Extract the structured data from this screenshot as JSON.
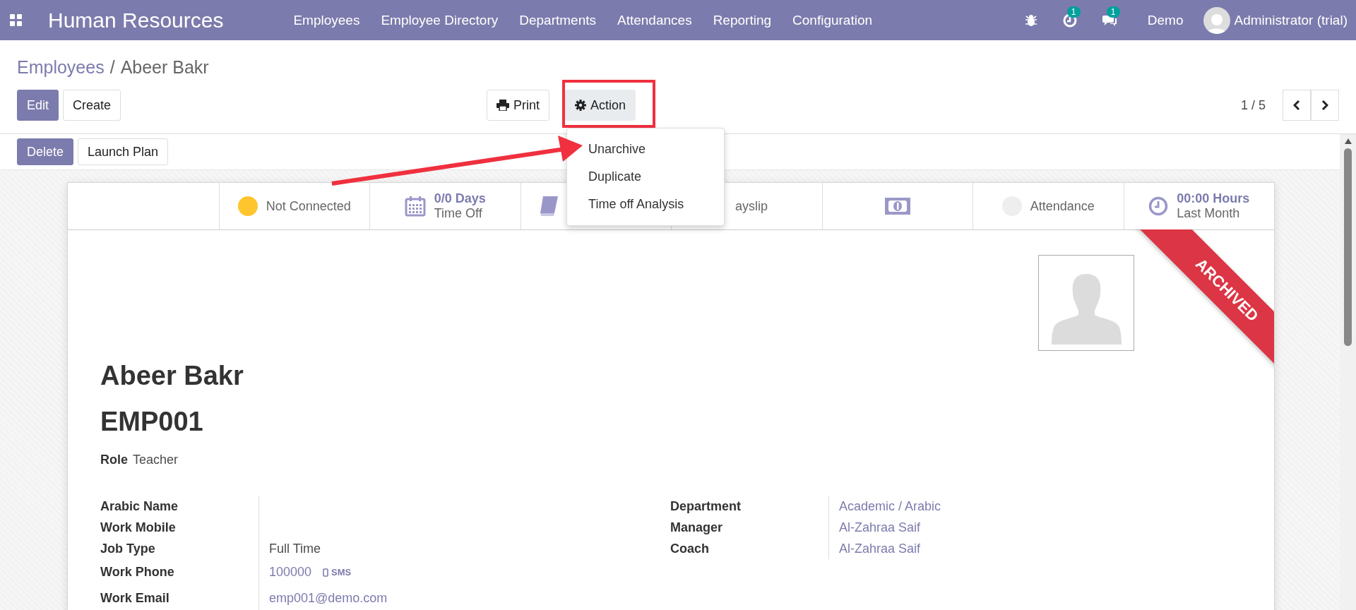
{
  "navbar": {
    "app_title": "Human Resources",
    "menu": [
      "Employees",
      "Employee Directory",
      "Departments",
      "Attendances",
      "Reporting",
      "Configuration"
    ],
    "activity_badge": "1",
    "message_badge": "1",
    "company": "Demo",
    "user": "Administrator (trial)"
  },
  "breadcrumb": {
    "parent": "Employees",
    "separator": "/",
    "current": "Abeer Bakr"
  },
  "toolbar": {
    "buttons": [
      {
        "label": "Edit",
        "kind": "primary"
      },
      {
        "label": "Create",
        "kind": "secondary"
      }
    ],
    "print": "Print",
    "action": "Action",
    "pager": "1 / 5"
  },
  "status_row": [
    {
      "label": "Delete",
      "kind": "primary"
    },
    {
      "label": "Launch Plan",
      "kind": "secondary"
    }
  ],
  "action_menu": {
    "items": [
      "Unarchive",
      "Duplicate",
      "Time off Analysis"
    ]
  },
  "stats": [
    {
      "kind": "presence",
      "label": "Not Connected",
      "color": "#ffc52f"
    },
    {
      "kind": "time_off",
      "value": "0/0 Days",
      "label": "Time Off"
    },
    {
      "kind": "contracts"
    },
    {
      "kind": "payslip",
      "label": "ayslip"
    },
    {
      "kind": "money"
    },
    {
      "kind": "attendance",
      "label": "Attendance",
      "color": "#eeeeee"
    },
    {
      "kind": "hours",
      "value": "00:00 Hours",
      "label": "Last Month"
    }
  ],
  "ribbon": "ARCHIVED",
  "employee": {
    "name": "Abeer Bakr",
    "code": "EMP001",
    "role_label": "Role",
    "role": "Teacher"
  },
  "fields_left": [
    {
      "label": "Arabic Name",
      "kind": "empty"
    },
    {
      "label": "Work Mobile",
      "kind": "empty"
    },
    {
      "label": "Job Type",
      "kind": "text",
      "value": "Full Time"
    },
    {
      "label": "Work Phone",
      "kind": "phone",
      "value": "100000",
      "action": "SMS"
    },
    {
      "label": "Work Email",
      "kind": "link",
      "value": "emp001@demo.com"
    }
  ],
  "fields_right": [
    {
      "label": "Department",
      "kind": "link",
      "value": "Academic / Arabic"
    },
    {
      "label": "Manager",
      "kind": "link",
      "value": "Al-Zahraa Saif"
    },
    {
      "label": "Coach",
      "kind": "link",
      "value": "Al-Zahraa Saif"
    }
  ]
}
